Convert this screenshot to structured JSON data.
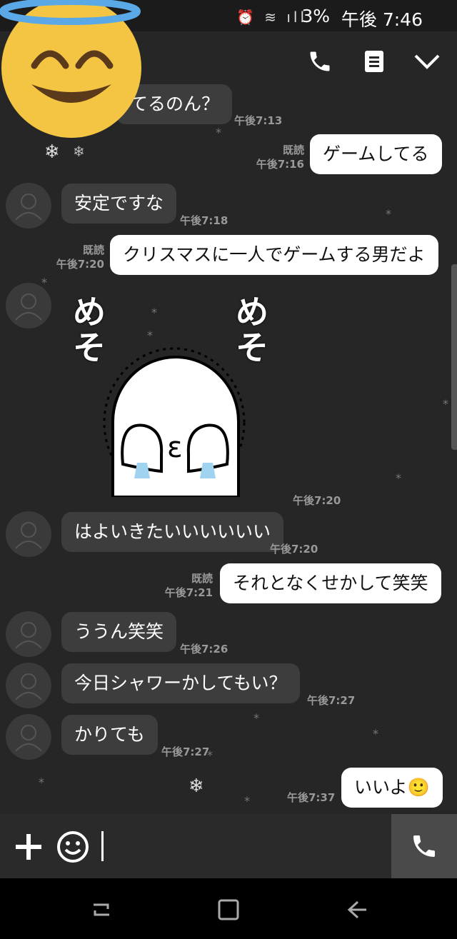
{
  "status": {
    "battery": "3%",
    "time": "午後 7:46"
  },
  "header": {
    "call_icon": "phone-icon",
    "notes_icon": "note-icon",
    "menu_icon": "chevron-down-icon"
  },
  "messages": [
    {
      "dir": "in",
      "text": "てるのん？",
      "time": "午後7:13"
    },
    {
      "dir": "out",
      "text": "ゲームしてる",
      "read": "既読",
      "time": "午後7:16"
    },
    {
      "dir": "in",
      "text": "安定ですな",
      "time": "午後7:18"
    },
    {
      "dir": "out",
      "text": "クリスマスに一人でゲームする男だよ",
      "read": "既読",
      "time": "午後7:20"
    },
    {
      "dir": "in",
      "sticker": true,
      "sticker_text_left": "めそ",
      "sticker_text_right": "めそ",
      "sticker_face": "ε",
      "time": "午後7:20"
    },
    {
      "dir": "in",
      "text": "はよいきたいいいいいい",
      "time": "午後7:20"
    },
    {
      "dir": "out",
      "text": "それとなくせかして笑笑",
      "read": "既読",
      "time": "午後7:21"
    },
    {
      "dir": "in",
      "text": "ううん笑笑",
      "time": "午後7:26"
    },
    {
      "dir": "in",
      "text": "今日シャワーかしてもい？",
      "time": "午後7:27"
    },
    {
      "dir": "in",
      "text": "かりても",
      "time": "午後7:27"
    },
    {
      "dir": "out",
      "text": "いいよ",
      "emoji": "🙂",
      "time": "午後7:37"
    }
  ],
  "input": {
    "plus_icon": "plus-icon",
    "emoji_icon": "smiley-icon",
    "call_icon": "phone-icon"
  },
  "nav": {
    "recent_icon": "recent-apps-icon",
    "home_icon": "home-icon",
    "back_icon": "back-icon"
  }
}
